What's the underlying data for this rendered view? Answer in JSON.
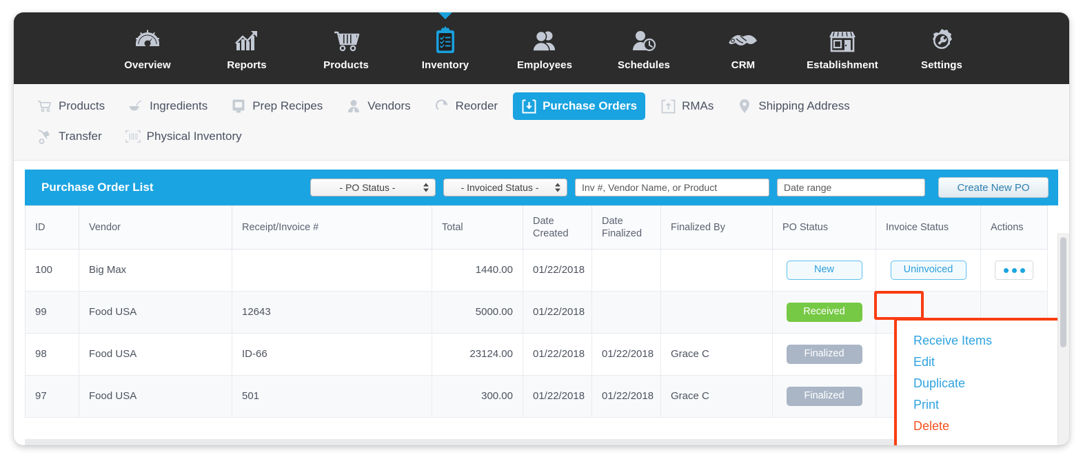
{
  "topnav": {
    "items": [
      {
        "label": "Overview",
        "icon": "gauge-icon",
        "active": false
      },
      {
        "label": "Reports",
        "icon": "bar-chart-arrow-icon",
        "active": false
      },
      {
        "label": "Products",
        "icon": "shopping-cart-icon",
        "active": false
      },
      {
        "label": "Inventory",
        "icon": "clipboard-checklist-icon",
        "active": true
      },
      {
        "label": "Employees",
        "icon": "two-people-icon",
        "active": false
      },
      {
        "label": "Schedules",
        "icon": "person-clock-icon",
        "active": false
      },
      {
        "label": "CRM",
        "icon": "handshake-icon",
        "active": false
      },
      {
        "label": "Establishment",
        "icon": "storefront-icon",
        "active": false
      },
      {
        "label": "Settings",
        "icon": "gear-wrench-icon",
        "active": false
      }
    ]
  },
  "subnav": {
    "items": [
      {
        "label": "Products",
        "icon": "shopping-cart-icon",
        "active": false
      },
      {
        "label": "Ingredients",
        "icon": "mixing-bowl-icon",
        "active": false
      },
      {
        "label": "Prep Recipes",
        "icon": "recipe-book-icon",
        "active": false
      },
      {
        "label": "Vendors",
        "icon": "person-icon",
        "active": false
      },
      {
        "label": "Reorder",
        "icon": "refresh-icon",
        "active": false
      },
      {
        "label": "Purchase Orders",
        "icon": "download-box-icon",
        "active": true
      },
      {
        "label": "RMAs",
        "icon": "upload-box-icon",
        "active": false
      },
      {
        "label": "Shipping Address",
        "icon": "map-pin-icon",
        "active": false
      },
      {
        "label": "Transfer",
        "icon": "hand-truck-icon",
        "active": false
      },
      {
        "label": "Physical Inventory",
        "icon": "barcode-scan-icon",
        "active": false
      }
    ]
  },
  "toolbar": {
    "title": "Purchase Order List",
    "po_status_select": "- PO Status -",
    "invoiced_status_select": "- Invoiced Status -",
    "search_placeholder": "Inv #, Vendor Name, or Product",
    "search_value": "",
    "date_placeholder": "Date range",
    "date_value": "",
    "create_button": "Create New PO",
    "accent_color": "#1ba4e2"
  },
  "table": {
    "columns": [
      "ID",
      "Vendor",
      "Receipt/Invoice #",
      "Total",
      "Date\nCreated",
      "Date\nFinalized",
      "Finalized By",
      "PO Status",
      "Invoice Status",
      "Actions"
    ],
    "columns_flat": {
      "id": "ID",
      "vendor": "Vendor",
      "receipt": "Receipt/Invoice #",
      "total": "Total",
      "date_created_l1": "Date",
      "date_created_l2": "Created",
      "date_finalized_l1": "Date",
      "date_finalized_l2": "Finalized",
      "finalized_by": "Finalized By",
      "po_status": "PO Status",
      "invoice_status": "Invoice Status",
      "actions": "Actions"
    },
    "rows": [
      {
        "id": "100",
        "vendor": "Big Max",
        "receipt": "",
        "total": "1440.00",
        "date_created": "01/22/2018",
        "date_finalized": "",
        "finalized_by": "",
        "po_status": "New",
        "po_status_style": "outline",
        "invoice_status": "Uninvoiced",
        "invoice_status_style": "outline",
        "actions": "•••"
      },
      {
        "id": "99",
        "vendor": "Food USA",
        "receipt": "12643",
        "total": "5000.00",
        "date_created": "01/22/2018",
        "date_finalized": "",
        "finalized_by": "",
        "po_status": "Received",
        "po_status_style": "green",
        "invoice_status": "",
        "invoice_status_style": "none",
        "actions": ""
      },
      {
        "id": "98",
        "vendor": "Food USA",
        "receipt": "ID-66",
        "total": "23124.00",
        "date_created": "01/22/2018",
        "date_finalized": "01/22/2018",
        "finalized_by": "Grace C",
        "po_status": "Finalized",
        "po_status_style": "gray",
        "invoice_status": "",
        "invoice_status_style": "none",
        "actions": ""
      },
      {
        "id": "97",
        "vendor": "Food USA",
        "receipt": "501",
        "total": "300.00",
        "date_created": "01/22/2018",
        "date_finalized": "01/22/2018",
        "finalized_by": "Grace C",
        "po_status": "Finalized",
        "po_status_style": "gray",
        "invoice_status": "",
        "invoice_status_style": "none",
        "actions": ""
      }
    ],
    "status_colors": {
      "new": "#2e9fd7",
      "received": "#76c944",
      "finalized": "#aab6c6",
      "uninvoiced": "#2e9fd7"
    }
  },
  "actions_menu": {
    "items": [
      {
        "label": "Receive Items",
        "danger": false
      },
      {
        "label": "Edit",
        "danger": false
      },
      {
        "label": "Duplicate",
        "danger": false
      },
      {
        "label": "Print",
        "danger": false
      },
      {
        "label": "Delete",
        "danger": true
      }
    ],
    "highlight_color": "#f93d12"
  }
}
